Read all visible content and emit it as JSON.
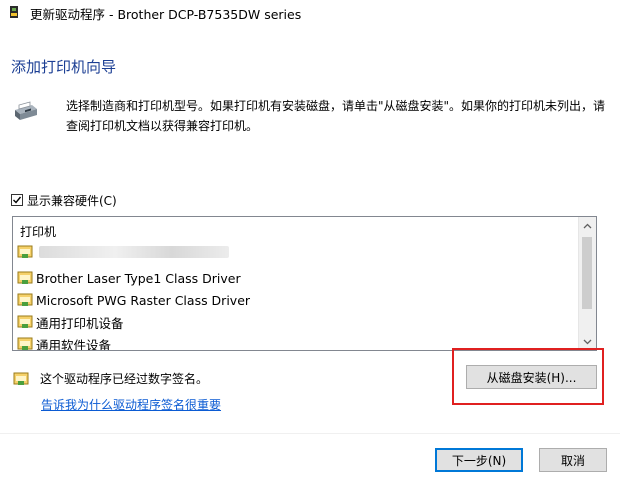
{
  "window": {
    "title": "更新驱动程序 - Brother DCP-B7535DW series"
  },
  "wizard": {
    "heading": "添加打印机向导",
    "instructions": "选择制造商和打印机型号。如果打印机有安装磁盘，请单击\"从磁盘安装\"。如果你的打印机未列出，请查阅打印机文档以获得兼容打印机。"
  },
  "compatible_hardware": {
    "label": "显示兼容硬件(C)",
    "checked": true
  },
  "printer_list": {
    "header": "打印机",
    "items": [
      {
        "label": "",
        "redacted": true
      },
      {
        "label": "Brother Laser Type1 Class Driver"
      },
      {
        "label": "Microsoft PWG Raster Class Driver"
      },
      {
        "label": "通用打印机设备"
      },
      {
        "label": "通用软件设备"
      }
    ]
  },
  "signature": {
    "status_text": "这个驱动程序已经过数字签名。",
    "why_link": "告诉我为什么驱动程序签名很重要"
  },
  "buttons": {
    "have_disk": "从磁盘安装(H)...",
    "next": "下一步(N)",
    "cancel": "取消"
  },
  "icons": {
    "app": "printer-driver-icon",
    "wizard": "printer-icon",
    "driver": "certified-driver-icon",
    "scroll_up": "chevron-up-icon",
    "scroll_down": "chevron-down-icon"
  },
  "colors": {
    "heading": "#1c3f94",
    "link": "#0b5bd3",
    "highlight": "#e02020",
    "primary_button_border": "#0078d7"
  }
}
